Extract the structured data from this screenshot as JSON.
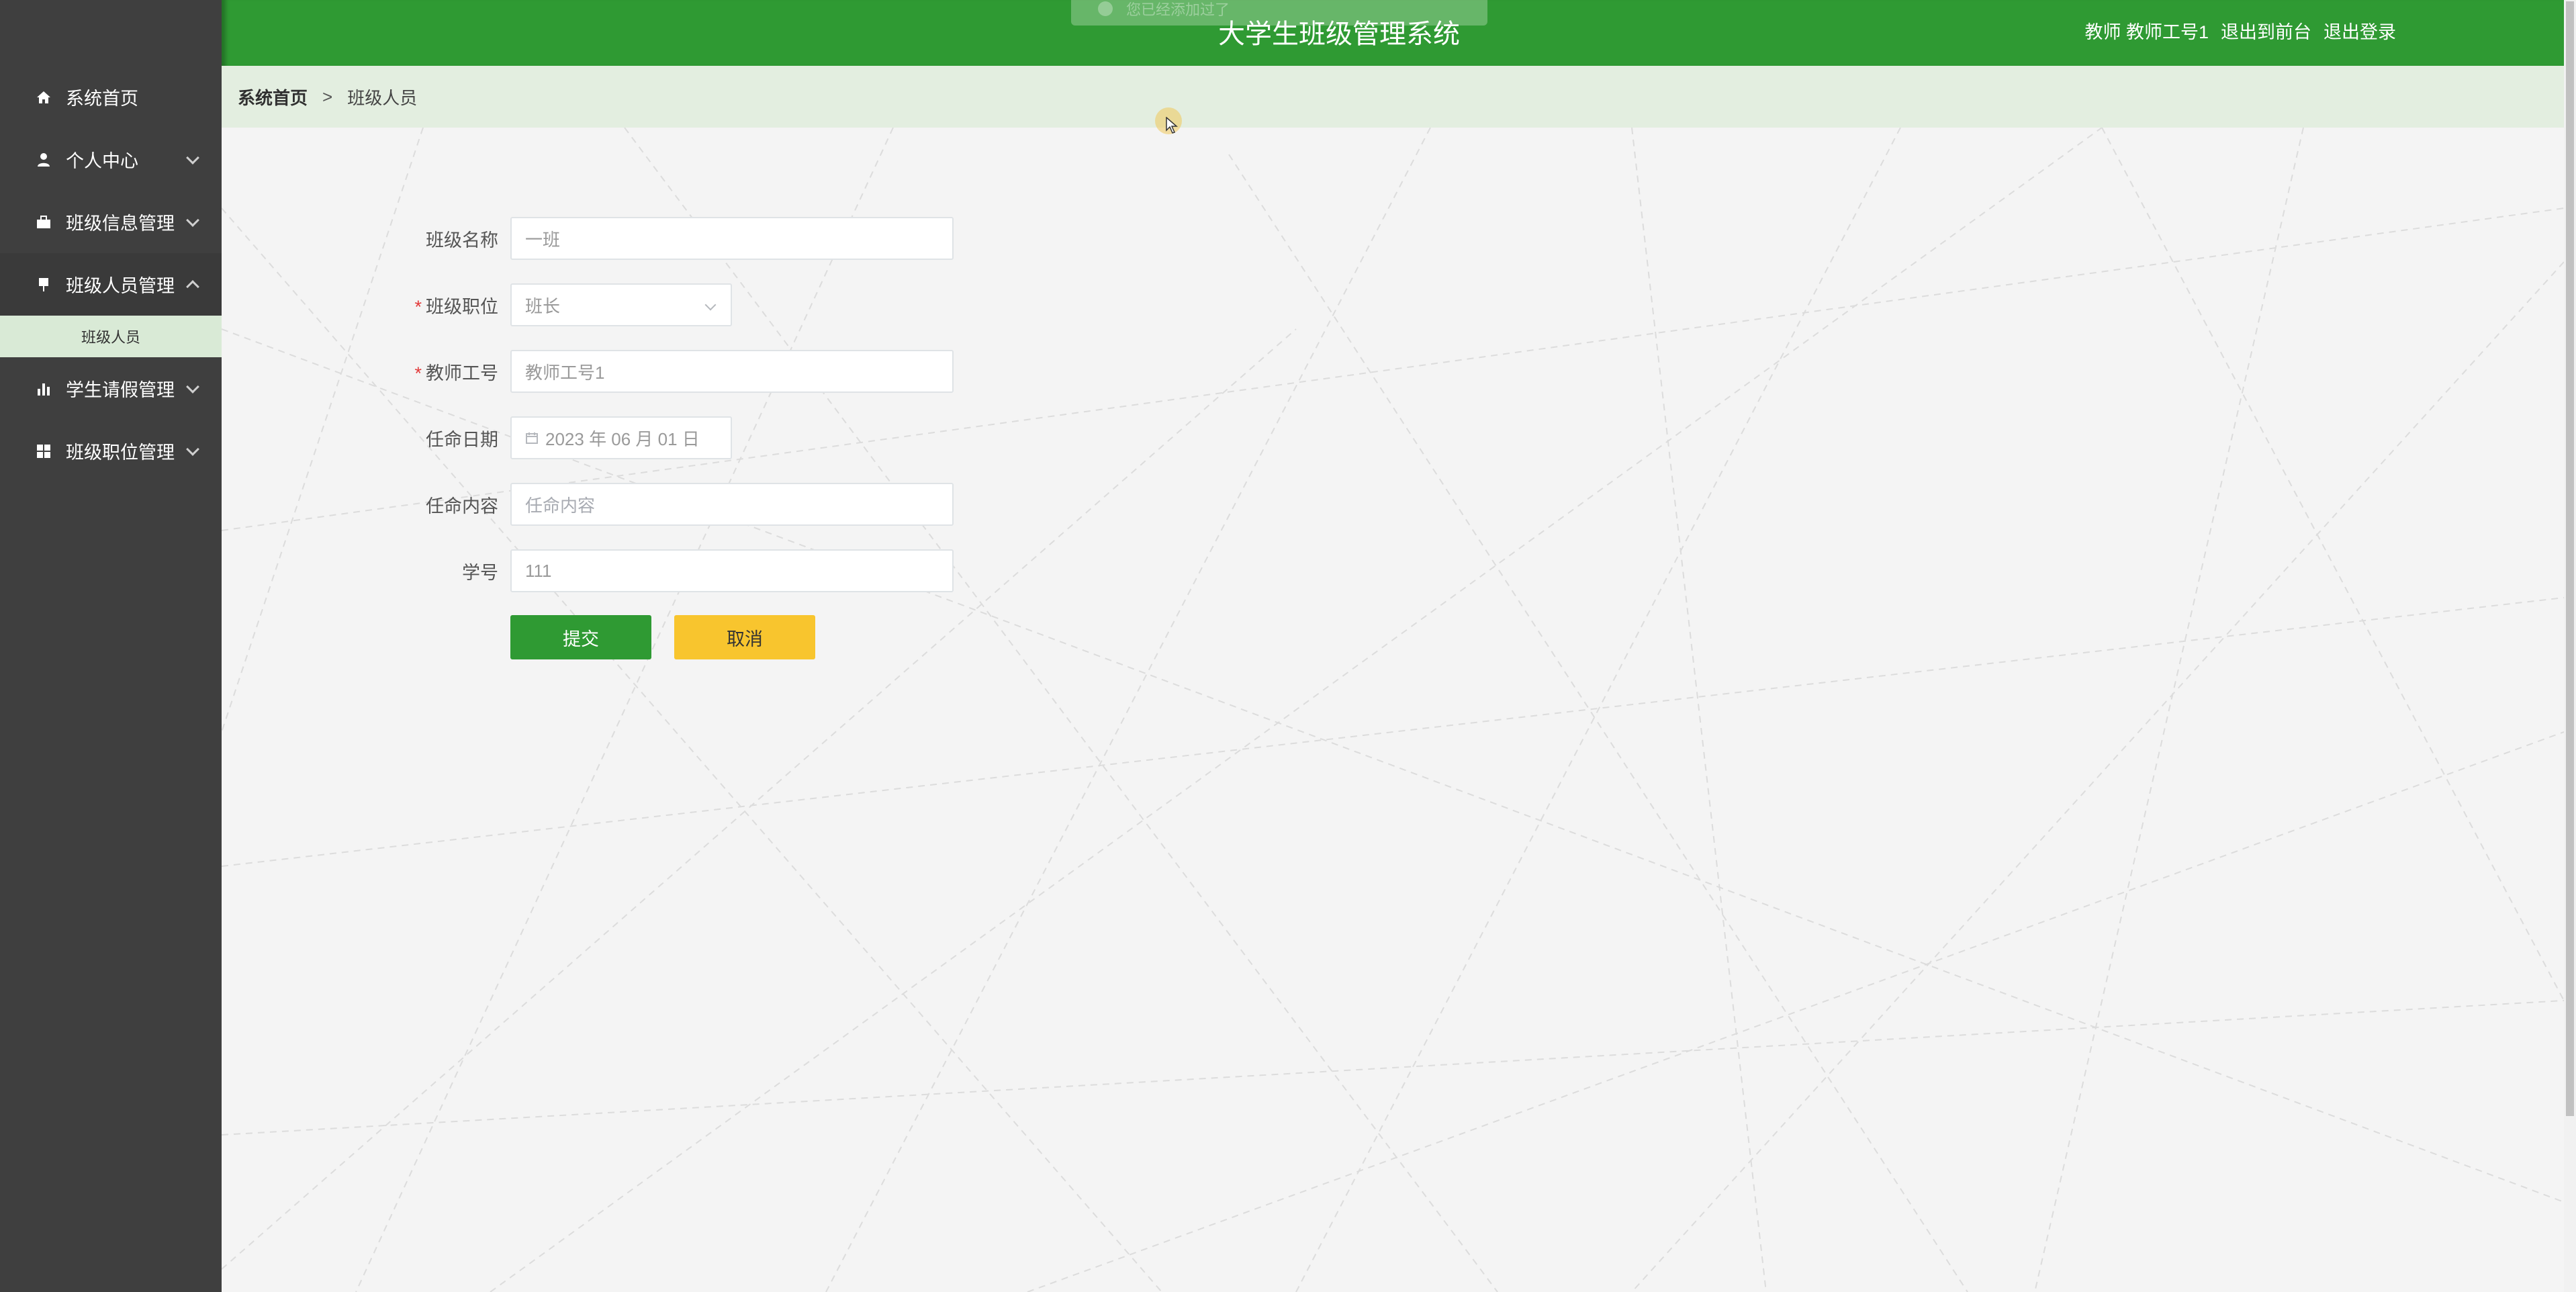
{
  "app": {
    "title": "大学生班级管理系统"
  },
  "header": {
    "user_role": "教师",
    "user_name": "教师工号1",
    "to_front_label": "退出到前台",
    "logout_label": "退出登录",
    "toast_text": "您已经添加过了"
  },
  "sidebar": {
    "items": [
      {
        "label": "系统首页",
        "icon": "home-icon"
      },
      {
        "label": "个人中心",
        "icon": "user-icon"
      },
      {
        "label": "班级信息管理",
        "icon": "briefcase-icon"
      },
      {
        "label": "班级人员管理",
        "icon": "pin-icon"
      },
      {
        "label": "学生请假管理",
        "icon": "bar-chart-icon"
      },
      {
        "label": "班级职位管理",
        "icon": "grid-icon"
      }
    ],
    "submenu": {
      "label": "班级人员"
    }
  },
  "breadcrumb": {
    "home": "系统首页",
    "separator": ">",
    "current": "班级人员"
  },
  "form": {
    "class_name": {
      "label": "班级名称",
      "value": "一班"
    },
    "position": {
      "label": "班级职位",
      "value": "班长"
    },
    "teacher_id": {
      "label": "教师工号",
      "value": "教师工号1"
    },
    "appoint_date": {
      "label": "任命日期",
      "value": "2023 年 06 月 01 日"
    },
    "appoint_content": {
      "label": "任命内容",
      "placeholder": "任命内容"
    },
    "student_id": {
      "label": "学号",
      "value": "111"
    },
    "submit_label": "提交",
    "cancel_label": "取消"
  },
  "colors": {
    "header_green": "#2f9a33",
    "sidebar_dark": "#3f3f3f",
    "cancel_yellow": "#f8c52e",
    "breadcrumb_bg": "#e3eee0"
  }
}
